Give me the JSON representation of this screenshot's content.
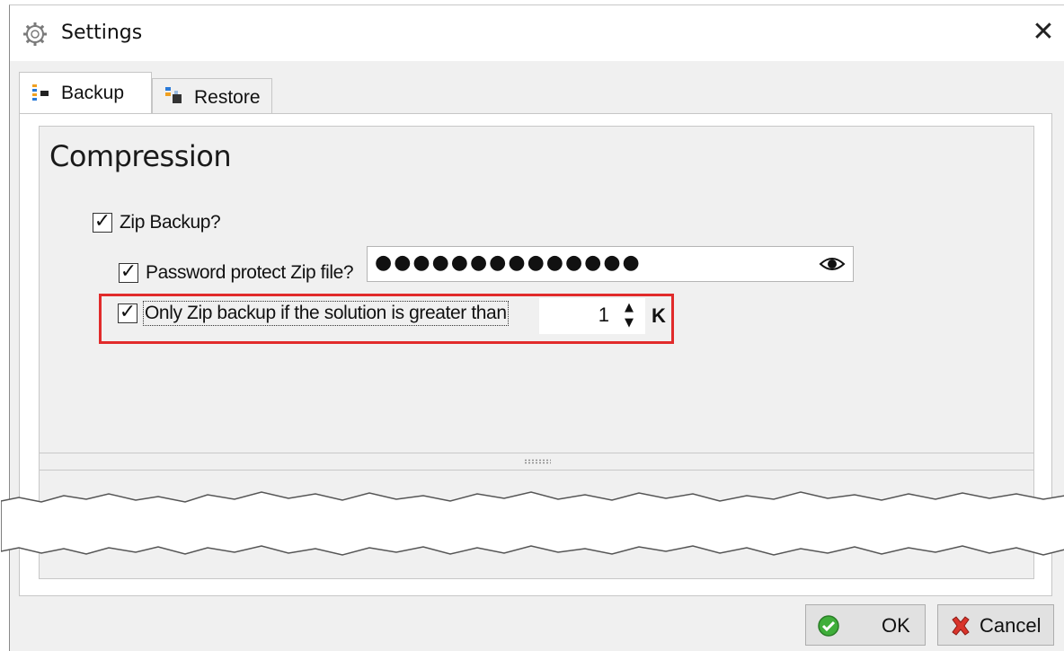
{
  "window": {
    "title": "Settings",
    "title_icon": "gear-icon",
    "close_glyph": "✕"
  },
  "tabs": [
    {
      "label": "Backup",
      "icon": "backup-icon",
      "selected": true
    },
    {
      "label": "Restore",
      "icon": "restore-icon",
      "selected": false
    }
  ],
  "compression": {
    "title": "Compression",
    "zip_backup": {
      "label": "Zip Backup?",
      "checked": true
    },
    "password_protect": {
      "label": "Password protect Zip file?",
      "checked": true
    },
    "password_value": "●●●●●●●●●●●●●●",
    "only_zip_if_greater": {
      "label": "Only Zip backup if the solution is greater than",
      "checked": true
    },
    "size_threshold": "1",
    "size_unit": "K",
    "highlight_color": "#e12b2b"
  },
  "buttons": {
    "ok_label": "OK",
    "cancel_label": "Cancel"
  }
}
